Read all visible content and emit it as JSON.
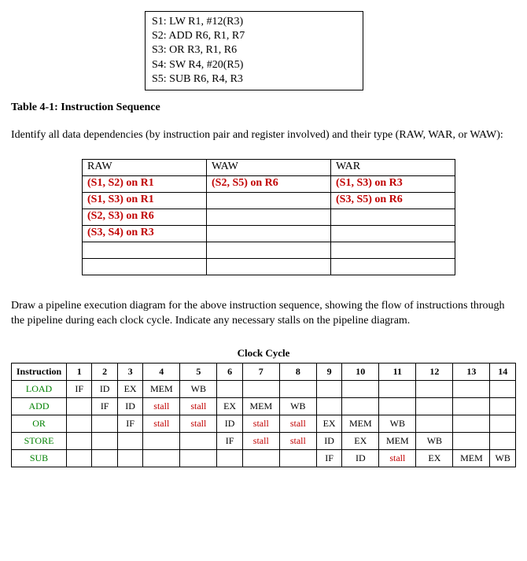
{
  "instructions": {
    "s1": "S1: LW R1, #12(R3)",
    "s2": "S2: ADD R6, R1, R7",
    "s3": "S3: OR R3, R1, R6",
    "s4": "S4: SW R4, #20(R5)",
    "s5": "S5: SUB R6, R4, R3"
  },
  "caption": "Table 4-1: Instruction Sequence",
  "prompt1": "Identify all data dependencies (by instruction pair and register involved) and their type (RAW, WAR, or WAW):",
  "dep": {
    "hdr_raw": "RAW",
    "hdr_waw": "WAW",
    "hdr_war": "WAR",
    "raw1": "(S1, S2) on R1",
    "raw2": "(S1, S3) on R1",
    "raw3": "(S2, S3) on R6",
    "raw4": "(S3, S4) on R3",
    "waw1": "(S2, S5) on R6",
    "war1": "(S1, S3) on R3",
    "war2": "(S3, S5) on R6"
  },
  "prompt2": "Draw a pipeline execution diagram for the above instruction sequence, showing the flow of instructions through the pipeline during each clock cycle. Indicate any necessary stalls on the pipeline diagram.",
  "pipe": {
    "title": "Clock Cycle",
    "col_instr": "Instruction",
    "c1": "1",
    "c2": "2",
    "c3": "3",
    "c4": "4",
    "c5": "5",
    "c6": "6",
    "c7": "7",
    "c8": "8",
    "c9": "9",
    "c10": "10",
    "c11": "11",
    "c12": "12",
    "c13": "13",
    "c14": "14",
    "load": "LOAD",
    "add": "ADD",
    "or": "OR",
    "store": "STORE",
    "sub": "SUB",
    "IF": "IF",
    "ID": "ID",
    "EX": "EX",
    "MEM": "MEM",
    "WB": "WB",
    "stall": "stall"
  }
}
